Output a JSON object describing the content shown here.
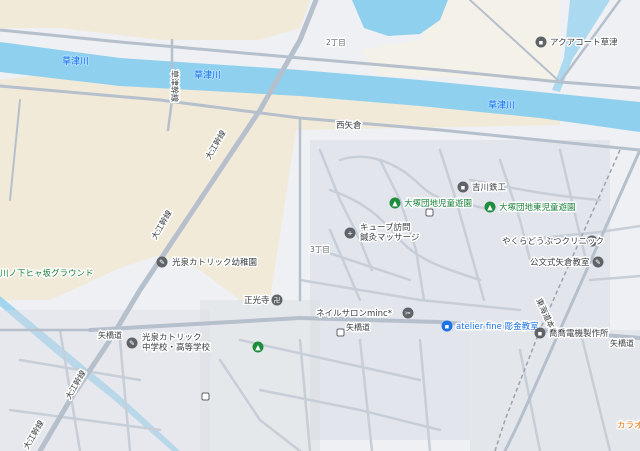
{
  "map": {
    "colors": {
      "river": "#8fd0ee",
      "river_label": "#1a73e8",
      "field": "#f1ead8",
      "land": "#eef0f3",
      "road_major": "#b6bfcc",
      "road_minor": "#c7ced8",
      "poi_gray": "#5f6368",
      "poi_green": "#1e8e3e",
      "poi_blue": "#1a73e8",
      "label_green": "#188038"
    },
    "labels": {
      "river_1": "草津川",
      "river_2": "草津川",
      "river_3": "草津川",
      "district_nishiyakura": "西矢倉",
      "chome_2": "2丁目",
      "chome_3": "3丁目",
      "road_oebanshu_1": "大江幹線",
      "road_oebanshu_2": "大江幹線",
      "road_oebanshu_3": "大江幹線",
      "road_oebanshu_4": "大江幹線",
      "road_yabashi_1": "矢橋道",
      "road_yabashi_2": "矢橋道",
      "road_yabashi_3": "矢橋道",
      "road_small_vertical": "草津幹線",
      "road_right_diag": "東海道本線"
    },
    "pois": [
      {
        "label": "アクアコート草津",
        "icon": "building-icon",
        "color": "gray"
      },
      {
        "label": "吉川鉄工",
        "icon": "factory-icon",
        "color": "gray"
      },
      {
        "label": "大塚団地児童遊園",
        "icon": "park-icon",
        "color": "green"
      },
      {
        "label": "大塚団地東児童遊園",
        "icon": "park-icon",
        "color": "green"
      },
      {
        "label": "キューブ訪問\n鍼灸マッサージ",
        "icon": "medical-icon",
        "color": "gray"
      },
      {
        "label": "やくらどうぶつクリニック",
        "icon": "vet-icon",
        "color": "gray"
      },
      {
        "label": "公文式矢倉教室",
        "icon": "school-icon",
        "color": "gray"
      },
      {
        "label": "光泉カトリック幼稚園",
        "icon": "school-icon",
        "color": "gray"
      },
      {
        "label": "正光寺",
        "icon": "temple-icon",
        "color": "gray"
      },
      {
        "label": "ネイルサロンminc*",
        "icon": "salon-icon",
        "color": "gray"
      },
      {
        "label": "atelier fine 彫金教室",
        "icon": "class-icon",
        "color": "blue"
      },
      {
        "label": "光泉カトリック\n中学校・高等学校",
        "icon": "school-icon",
        "color": "gray"
      },
      {
        "label": "喬喬電機製作所",
        "icon": "factory-icon",
        "color": "gray"
      },
      {
        "label": "川ノ下ヒャ坂グラウンド",
        "icon": "field-icon",
        "color": "green"
      },
      {
        "label": "カラオ",
        "icon": "karaoke-icon",
        "color": "orange"
      }
    ]
  }
}
